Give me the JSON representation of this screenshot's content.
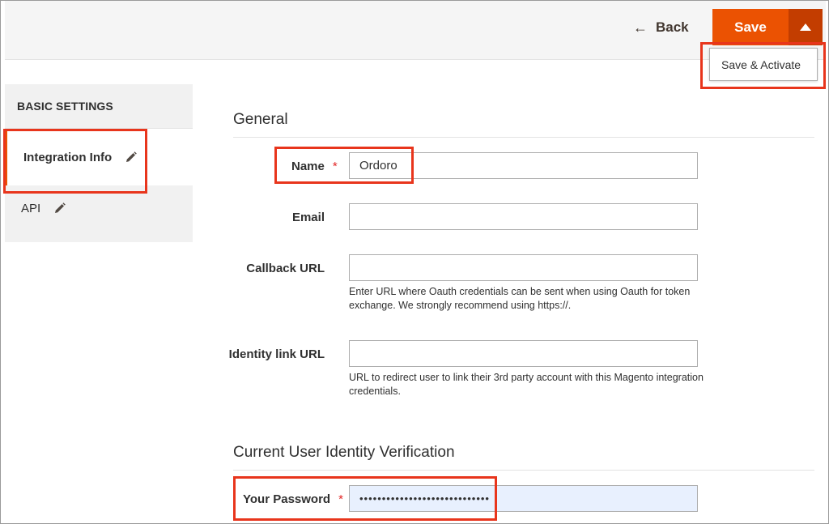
{
  "header": {
    "back_label": "Back",
    "save_label": "Save",
    "dropdown_item": "Save & Activate"
  },
  "sidebar": {
    "heading": "BASIC SETTINGS",
    "items": [
      {
        "label": "Integration Info",
        "active": true
      },
      {
        "label": "API",
        "active": false
      }
    ]
  },
  "general": {
    "title": "General",
    "fields": {
      "name": {
        "label": "Name",
        "required": "*",
        "value": "Ordoro"
      },
      "email": {
        "label": "Email",
        "value": ""
      },
      "callback": {
        "label": "Callback URL",
        "value": "",
        "note": "Enter URL where Oauth credentials can be sent when using Oauth for token exchange. We strongly recommend using https://."
      },
      "identity": {
        "label": "Identity link URL",
        "value": "",
        "note": "URL to redirect user to link their 3rd party account with this Magento integration credentials."
      }
    }
  },
  "verification": {
    "title": "Current User Identity Verification",
    "password": {
      "label": "Your Password",
      "required": "*",
      "value": "•••••••••••••••••••••••••••••"
    }
  },
  "colors": {
    "accent": "#eb5202",
    "accent_dark": "#c33d00",
    "highlight": "#e8351c"
  },
  "icons": [
    "back-arrow-icon",
    "caret-up-icon",
    "pencil-icon"
  ]
}
